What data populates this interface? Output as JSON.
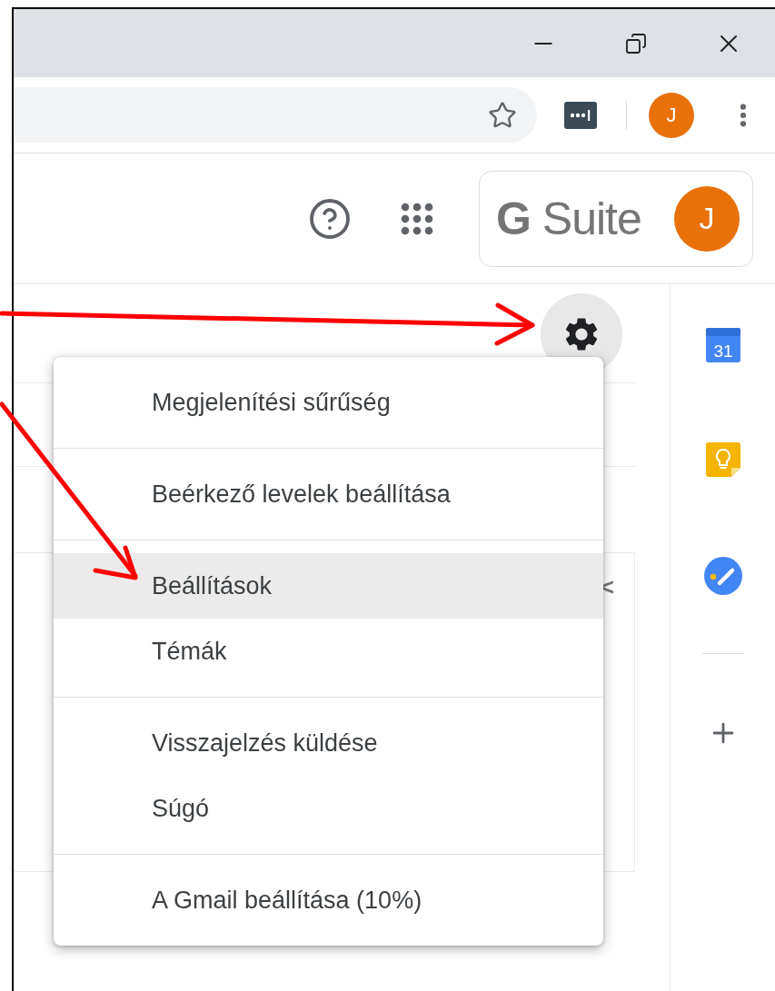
{
  "browser": {
    "profile_initial": "J"
  },
  "header": {
    "logo_text": "**G** Suite",
    "account_initial": "J"
  },
  "background_list": {
    "collapse_glyph": "<"
  },
  "side_panel": {
    "calendar_day": "31"
  },
  "settings_menu": {
    "groups": [
      {
        "items": [
          {
            "label": "Megjelenítési sűrűség",
            "selected": false
          }
        ]
      },
      {
        "items": [
          {
            "label": "Beérkező levelek beállítása",
            "selected": false
          }
        ]
      },
      {
        "items": [
          {
            "label": "Beállítások",
            "selected": true
          },
          {
            "label": "Témák",
            "selected": false
          }
        ]
      },
      {
        "items": [
          {
            "label": "Visszajelzés küldése",
            "selected": false
          },
          {
            "label": "Súgó",
            "selected": false
          }
        ]
      },
      {
        "items": [
          {
            "label": "A Gmail beállítása (10%)",
            "selected": false
          }
        ]
      }
    ]
  }
}
